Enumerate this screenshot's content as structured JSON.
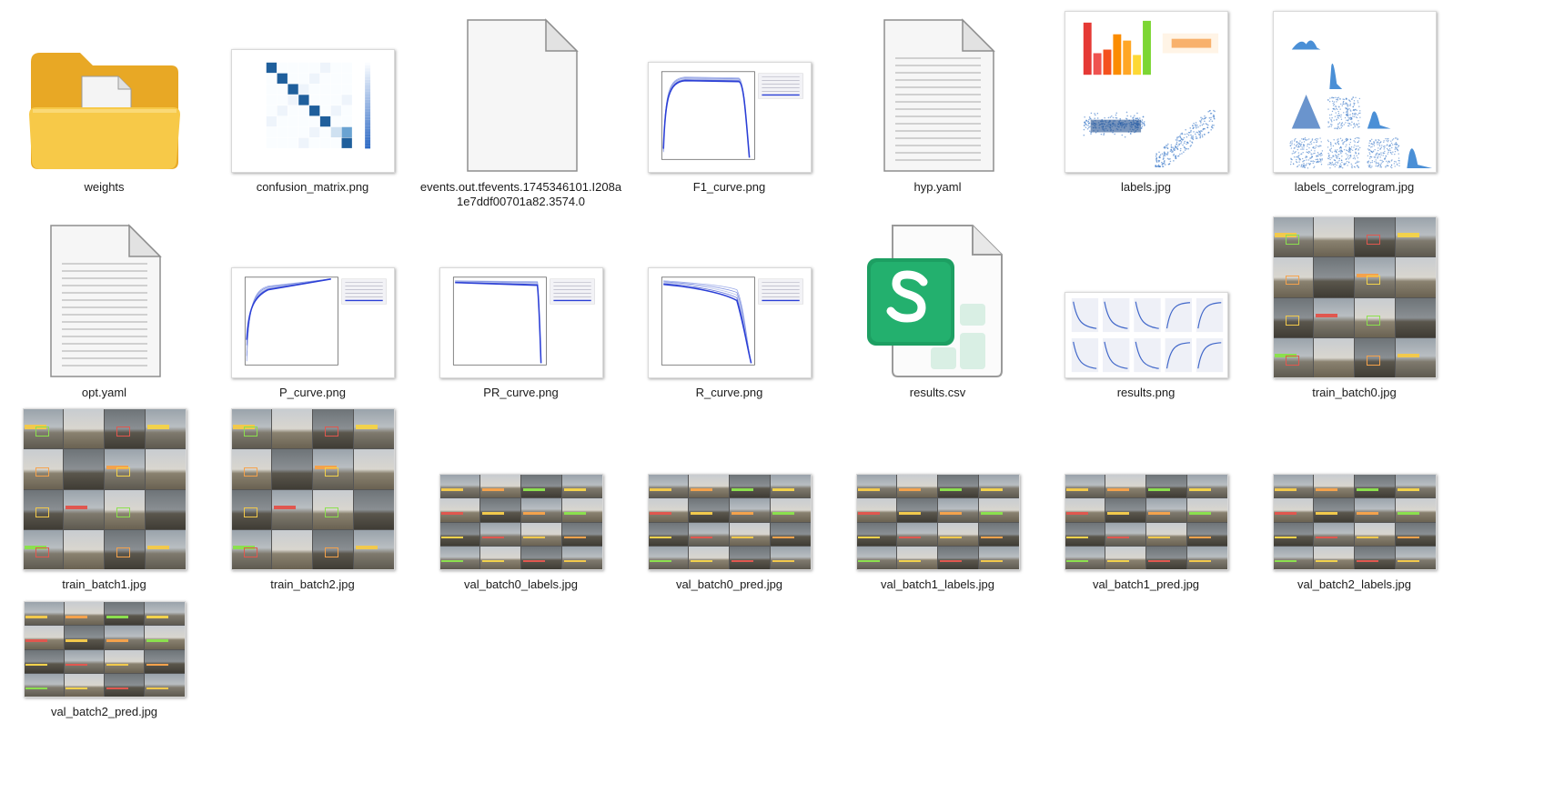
{
  "files": [
    {
      "name": "weights",
      "type": "folder"
    },
    {
      "name": "confusion_matrix.png",
      "type": "confusion"
    },
    {
      "name": "events.out.tfevents.1745346101.I208a1e7ddf00701a82.3574.0",
      "type": "blank"
    },
    {
      "name": "F1_curve.png",
      "type": "curve"
    },
    {
      "name": "hyp.yaml",
      "type": "text"
    },
    {
      "name": "labels.jpg",
      "type": "labels"
    },
    {
      "name": "labels_correlogram.jpg",
      "type": "correlogram"
    },
    {
      "name": "opt.yaml",
      "type": "text"
    },
    {
      "name": "P_curve.png",
      "type": "curve"
    },
    {
      "name": "PR_curve.png",
      "type": "curve"
    },
    {
      "name": "R_curve.png",
      "type": "curve"
    },
    {
      "name": "results.csv",
      "type": "csv"
    },
    {
      "name": "results.png",
      "type": "results"
    },
    {
      "name": "train_batch0.jpg",
      "type": "batch"
    },
    {
      "name": "train_batch1.jpg",
      "type": "batch"
    },
    {
      "name": "train_batch2.jpg",
      "type": "batch"
    },
    {
      "name": "val_batch0_labels.jpg",
      "type": "valbatch"
    },
    {
      "name": "val_batch0_pred.jpg",
      "type": "valbatch"
    },
    {
      "name": "val_batch1_labels.jpg",
      "type": "valbatch"
    },
    {
      "name": "val_batch1_pred.jpg",
      "type": "valbatch"
    },
    {
      "name": "val_batch2_labels.jpg",
      "type": "valbatch"
    },
    {
      "name": "val_batch2_pred.jpg",
      "type": "valbatch"
    }
  ],
  "colors": {
    "folder_back": "#e8a825",
    "folder_front": "#f7c948",
    "csv_green": "#1d9f62",
    "matrix_blue": "#1f5f9c",
    "curve_blue": "#2b3fd6"
  },
  "icons": {
    "folder": "folder-icon",
    "blank": "blank-file-icon",
    "text": "text-file-icon",
    "csv": "spreadsheet-icon"
  }
}
